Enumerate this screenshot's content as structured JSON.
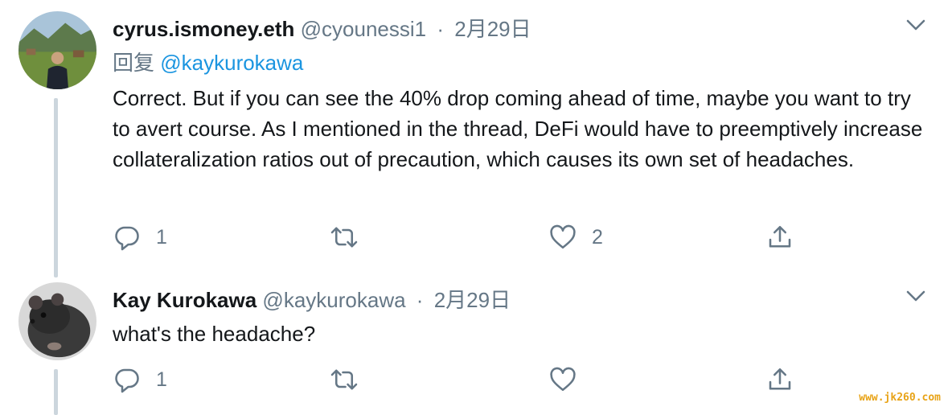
{
  "tweets": [
    {
      "display_name": "cyrus.ismoney.eth",
      "handle": "@cyounessi1",
      "date": "2月29日",
      "reply_prefix": "回复",
      "reply_mention": "@kaykurokawa",
      "text": "Correct. But if you can see the 40% drop coming ahead of time, maybe you want to try to avert course. As I mentioned in the thread, DeFi would have to preemptively increase collateralization ratios out of precaution, which causes its own set of headaches.",
      "reply_count": "1",
      "retweet_count": "",
      "like_count": "2"
    },
    {
      "display_name": "Kay Kurokawa",
      "handle": "@kaykurokawa",
      "date": "2月29日",
      "text": "what's the headache?",
      "reply_count": "1",
      "retweet_count": "",
      "like_count": ""
    }
  ],
  "separator": "·",
  "watermark": "www.jk260.com",
  "colors": {
    "text": "#14171a",
    "secondary": "#657786",
    "link": "#1b95e0",
    "thread_line": "#ccd6dd"
  },
  "icons": [
    "reply-icon",
    "retweet-icon",
    "like-icon",
    "share-icon",
    "chevron-down-icon"
  ]
}
